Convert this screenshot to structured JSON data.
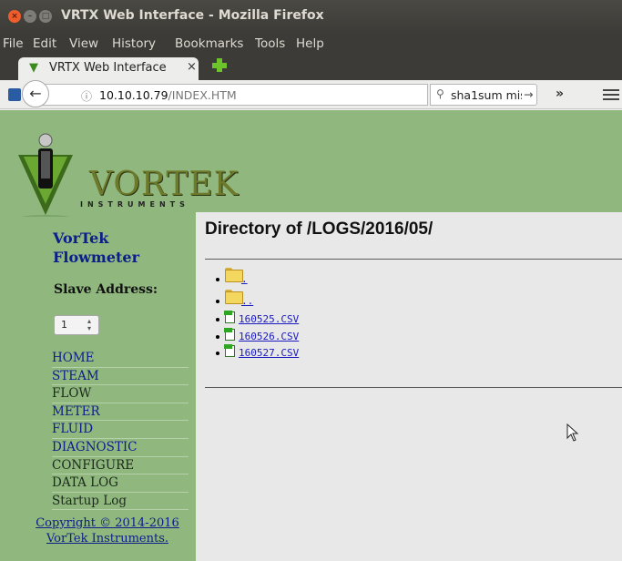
{
  "window": {
    "title": "VRTX Web Interface - Mozilla Firefox"
  },
  "menubar": [
    "File",
    "Edit",
    "View",
    "History",
    "Bookmarks",
    "Tools",
    "Help"
  ],
  "tab": {
    "title": "VRTX Web Interface",
    "close": "×"
  },
  "navbar": {
    "back": "←",
    "info": "ⓘ",
    "url_host": "10.10.10.79",
    "url_path": "/INDEX.HTM",
    "reload": "↻",
    "search_icon": "🔍",
    "search_text": "sha1sum mismatch",
    "search_go": "→",
    "overflow": "»"
  },
  "logo": {
    "name": "VORTEK",
    "tagline": "INSTRUMENTS"
  },
  "sidebar": {
    "brand_line1": "VorTek",
    "brand_line2": "Flowmeter",
    "slave_label": "Slave Address:",
    "slave_value": "1",
    "nav": [
      "HOME",
      "STEAM",
      "FLOW",
      "METER",
      "FLUID",
      "DIAGNOSTIC",
      "CONFIGURE",
      "DATA LOG",
      "Startup Log"
    ],
    "copyright_line1": "Copyright © 2014-2016",
    "copyright_line2": "VorTek Instruments."
  },
  "main": {
    "title": "Directory of /LOGS/2016/05/",
    "entries": [
      {
        "name": ".",
        "kind": "folder"
      },
      {
        "name": "..",
        "kind": "folder"
      },
      {
        "name": "160525.CSV",
        "kind": "csv"
      },
      {
        "name": "160526.CSV",
        "kind": "csv"
      },
      {
        "name": "160527.CSV",
        "kind": "csv"
      }
    ]
  },
  "colors": {
    "page_bg": "#8fb77e",
    "link": "#0b1e8a",
    "content_bg": "#e8e8e8"
  }
}
